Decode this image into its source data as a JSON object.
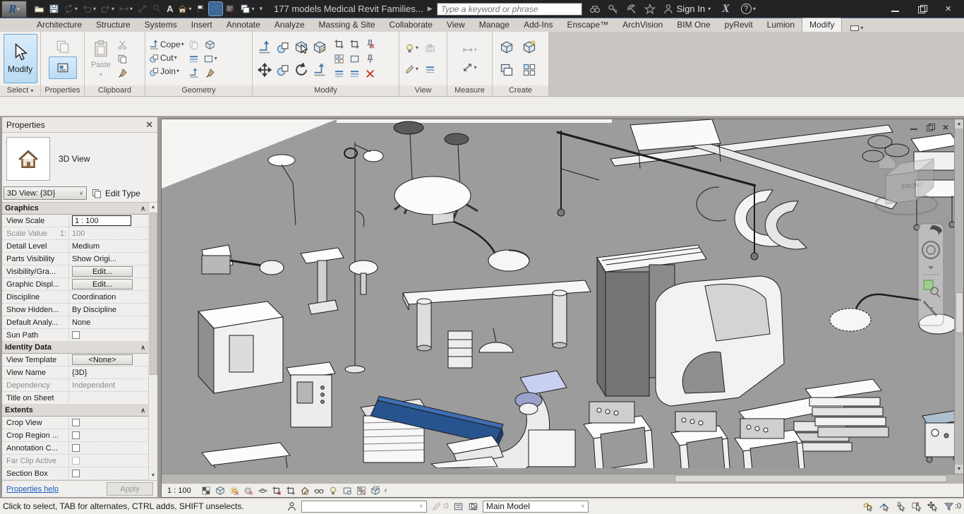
{
  "colors": {
    "accent_blue": "#b9dcf4",
    "viewport_bg": "#9c9c9c",
    "table_blue": "#27538f",
    "detector_panel": "#c9cff0",
    "link_blue": "#1b5dbd",
    "titlebar_bg": "#232323"
  },
  "titlebar": {
    "title": "177 models Medical Revit Families...",
    "search_placeholder": "Type a keyword or phrase",
    "sign_in": "Sign In",
    "exchange": "X",
    "help": "?"
  },
  "icon_names": {
    "qat": [
      "open",
      "save",
      "sync-with-central",
      "undo",
      "redo",
      "measure",
      "aligned-dimension",
      "tag-by-category",
      "text",
      "default-3d-view",
      "section",
      "thin-lines",
      "close-hidden-windows",
      "switch-windows",
      "customize-qat"
    ],
    "titlebar": [
      "search-binoculars",
      "help-keytip",
      "communication-center",
      "favorites",
      "sign-in-person",
      "exchange-apps",
      "help"
    ],
    "view_control": [
      "detail-level",
      "visual-style",
      "sun-path",
      "shadows",
      "show-rendering-dialog",
      "crop-view",
      "show-crop-region",
      "lock-3d-view",
      "temporary-hide-isolate",
      "reveal-hidden-elements",
      "temporary-view-properties",
      "show-analytical-model",
      "highlight-displacement-sets",
      "collapse"
    ],
    "status_right": [
      "select-links",
      "select-underlay-elements",
      "select-pinned-elements",
      "select-elements-by-face",
      "drag-elements-on-selection",
      "filter"
    ]
  },
  "ribbon": {
    "tabs": [
      "Architecture",
      "Structure",
      "Systems",
      "Insert",
      "Annotate",
      "Analyze",
      "Massing & Site",
      "Collaborate",
      "View",
      "Manage",
      "Add-Ins",
      "Enscape™",
      "ArchVision",
      "BIM One",
      "pyRevit",
      "Lumion",
      "Modify"
    ],
    "active_tab": "Modify",
    "panels": {
      "select": {
        "label": "Select",
        "modify_button": "Modify"
      },
      "properties": {
        "label": "Properties"
      },
      "clipboard": {
        "label": "Clipboard",
        "paste": "Paste"
      },
      "geometry": {
        "label": "Geometry",
        "cope": "Cope",
        "cut": "Cut",
        "join": "Join"
      },
      "modify": {
        "label": "Modify"
      },
      "view": {
        "label": "View"
      },
      "measure": {
        "label": "Measure"
      },
      "create": {
        "label": "Create"
      }
    }
  },
  "properties_palette": {
    "title": "Properties",
    "preview_type": "3D View",
    "type_selector": "3D View: {3D}",
    "edit_type": "Edit Type",
    "sections": [
      {
        "title": "Graphics",
        "rows": [
          {
            "label": "View Scale",
            "value": "1 : 100"
          },
          {
            "label": "Scale Value",
            "label2": "1:",
            "value": "100"
          },
          {
            "label": "Detail Level",
            "value": "Medium"
          },
          {
            "label": "Parts Visibility",
            "value": "Show Origi..."
          },
          {
            "label": "Visibility/Gra...",
            "value": "Edit..."
          },
          {
            "label": "Graphic Displ...",
            "value": "Edit..."
          },
          {
            "label": "Discipline",
            "value": "Coordination"
          },
          {
            "label": "Show Hidden...",
            "value": "By Discipline"
          },
          {
            "label": "Default Analy...",
            "value": "None"
          },
          {
            "label": "Sun Path",
            "value": ""
          }
        ]
      },
      {
        "title": "Identity Data",
        "rows": [
          {
            "label": "View Template",
            "value": "<None>"
          },
          {
            "label": "View Name",
            "value": "{3D}"
          },
          {
            "label": "Dependency",
            "value": "Independent"
          },
          {
            "label": "Title on Sheet",
            "value": ""
          }
        ]
      },
      {
        "title": "Extents",
        "rows": [
          {
            "label": "Crop View",
            "value": ""
          },
          {
            "label": "Crop Region ...",
            "value": ""
          },
          {
            "label": "Annotation C...",
            "value": ""
          },
          {
            "label": "Far Clip Active",
            "value": ""
          },
          {
            "label": "Section Box",
            "value": ""
          }
        ]
      }
    ],
    "help_link": "Properties help",
    "apply_label": "Apply"
  },
  "viewport": {
    "viewcube_label": "FRONT"
  },
  "view_control": {
    "scale": "1 : 100"
  },
  "status": {
    "hint": "Click to select, TAB for alternates, CTRL adds, SHIFT unselects.",
    "editing_requests": ":0",
    "main_model": "Main Model",
    "filter_count": ":0"
  }
}
